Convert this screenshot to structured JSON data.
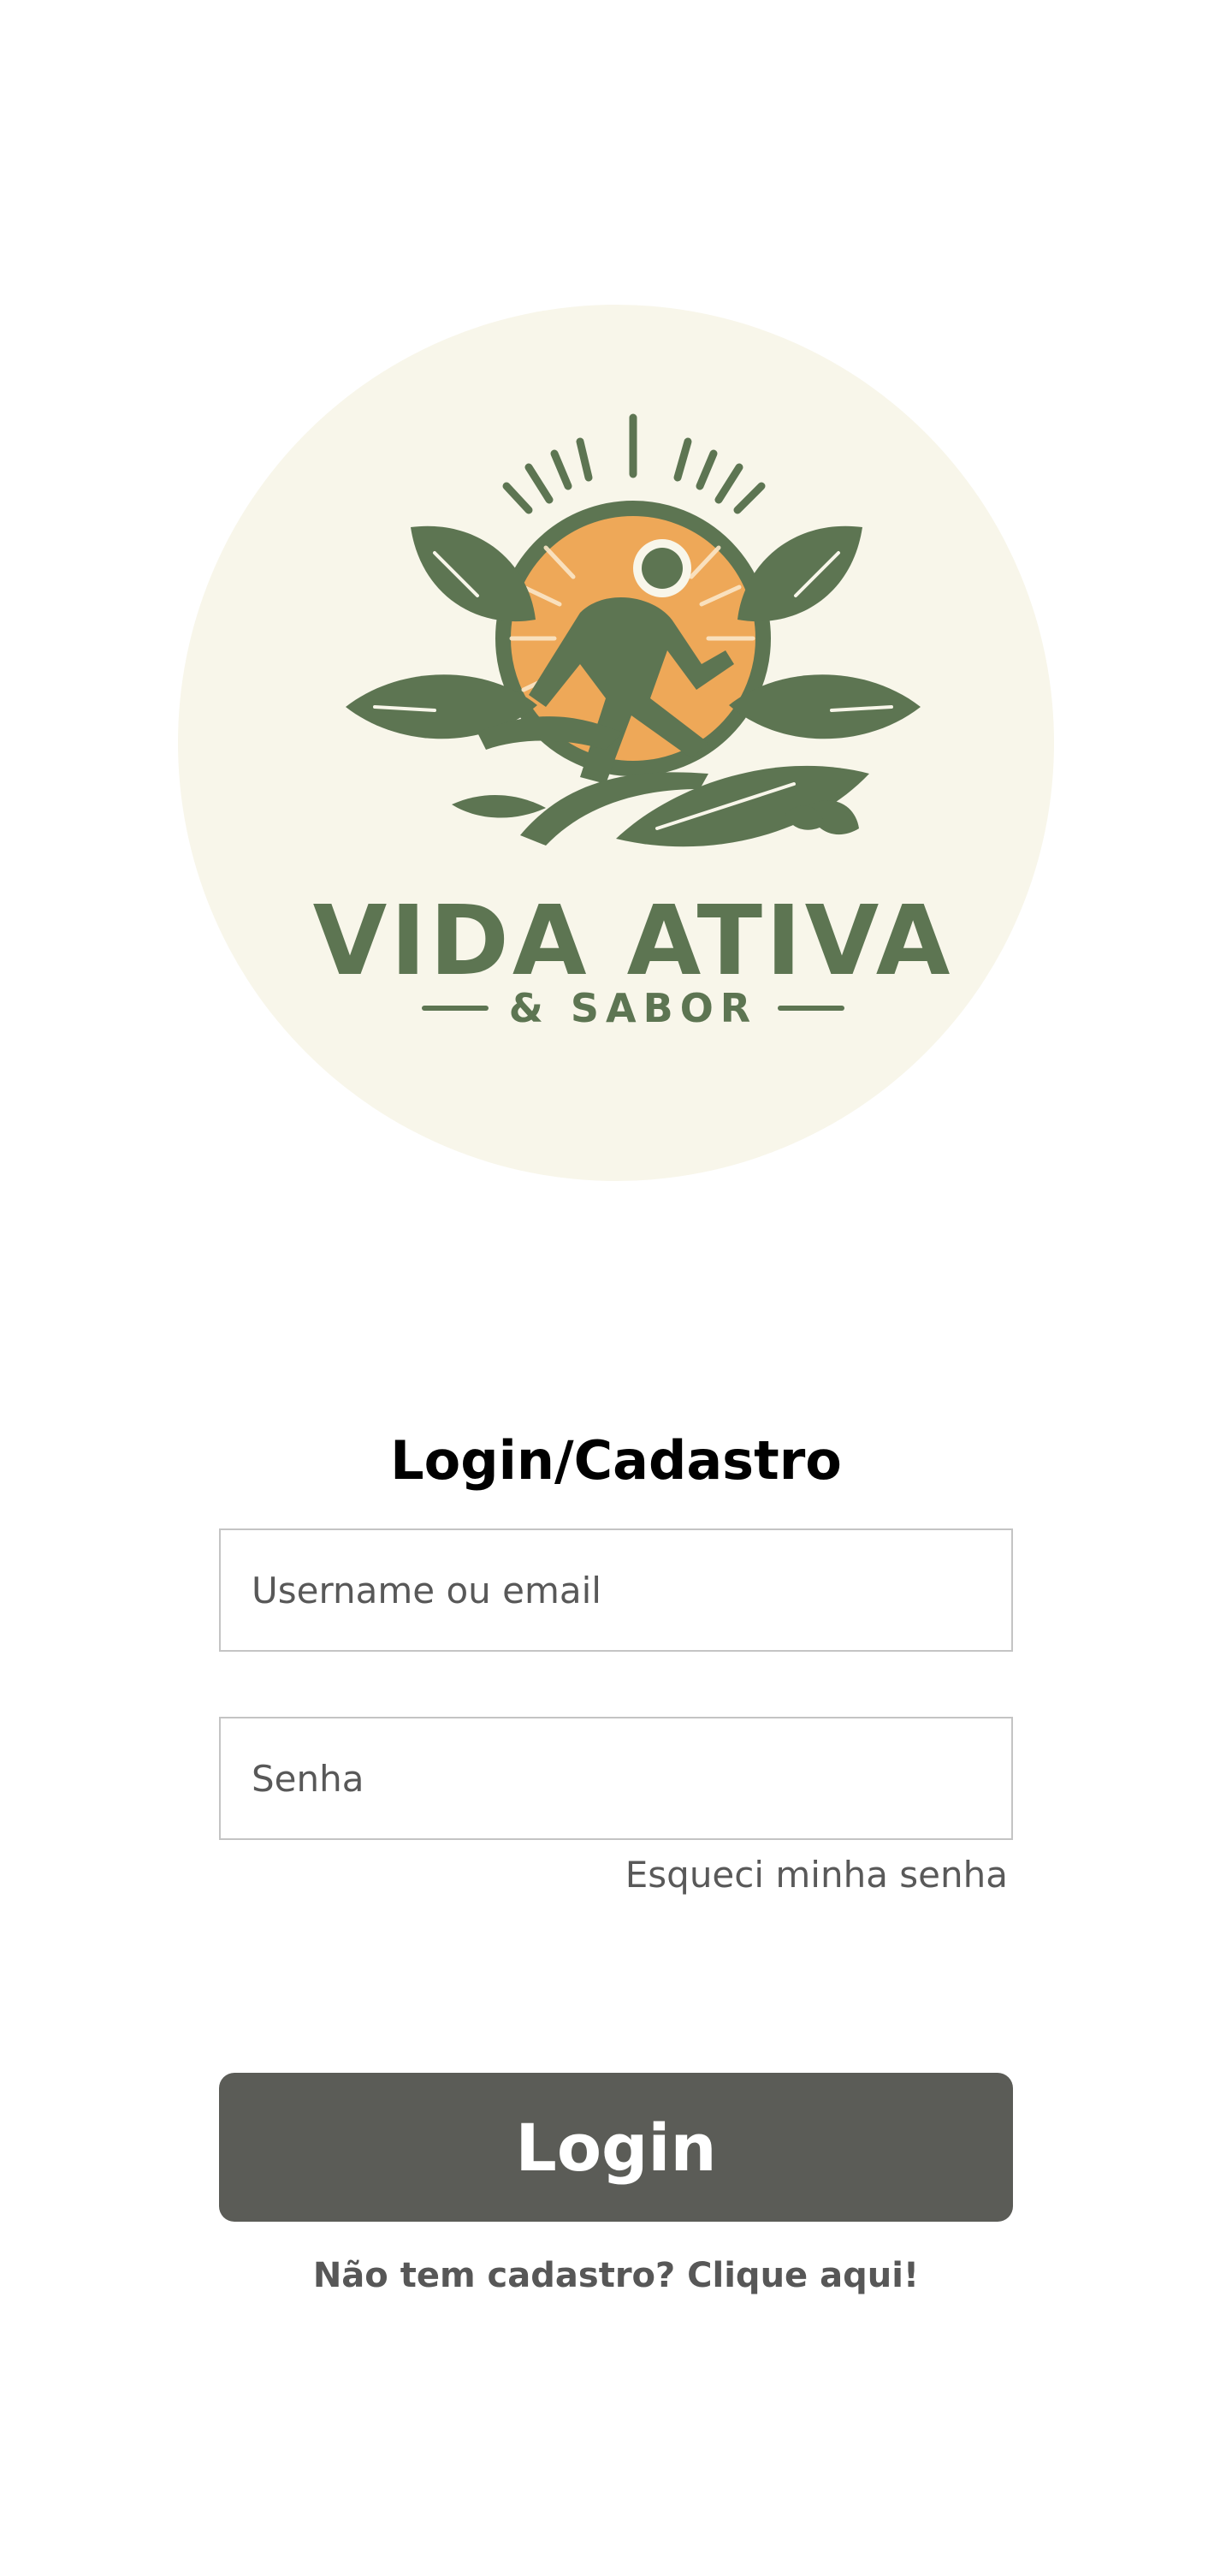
{
  "logo": {
    "brand_name": "VIDA ATIVA",
    "brand_sub": "& SABOR",
    "colors": {
      "circle_bg": "#f8f6ea",
      "green": "#5d7552",
      "orange": "#eea858",
      "ray": "#fbe7c8"
    }
  },
  "form": {
    "title": "Login/Cadastro",
    "username_placeholder": "Username ou email",
    "password_placeholder": "Senha",
    "forgot_label": "Esqueci minha senha",
    "login_label": "Login",
    "signup_label": "Não tem cadastro? Clique aqui!"
  },
  "colors": {
    "button_bg": "#5b5c57",
    "input_border": "#c4c4c4"
  }
}
